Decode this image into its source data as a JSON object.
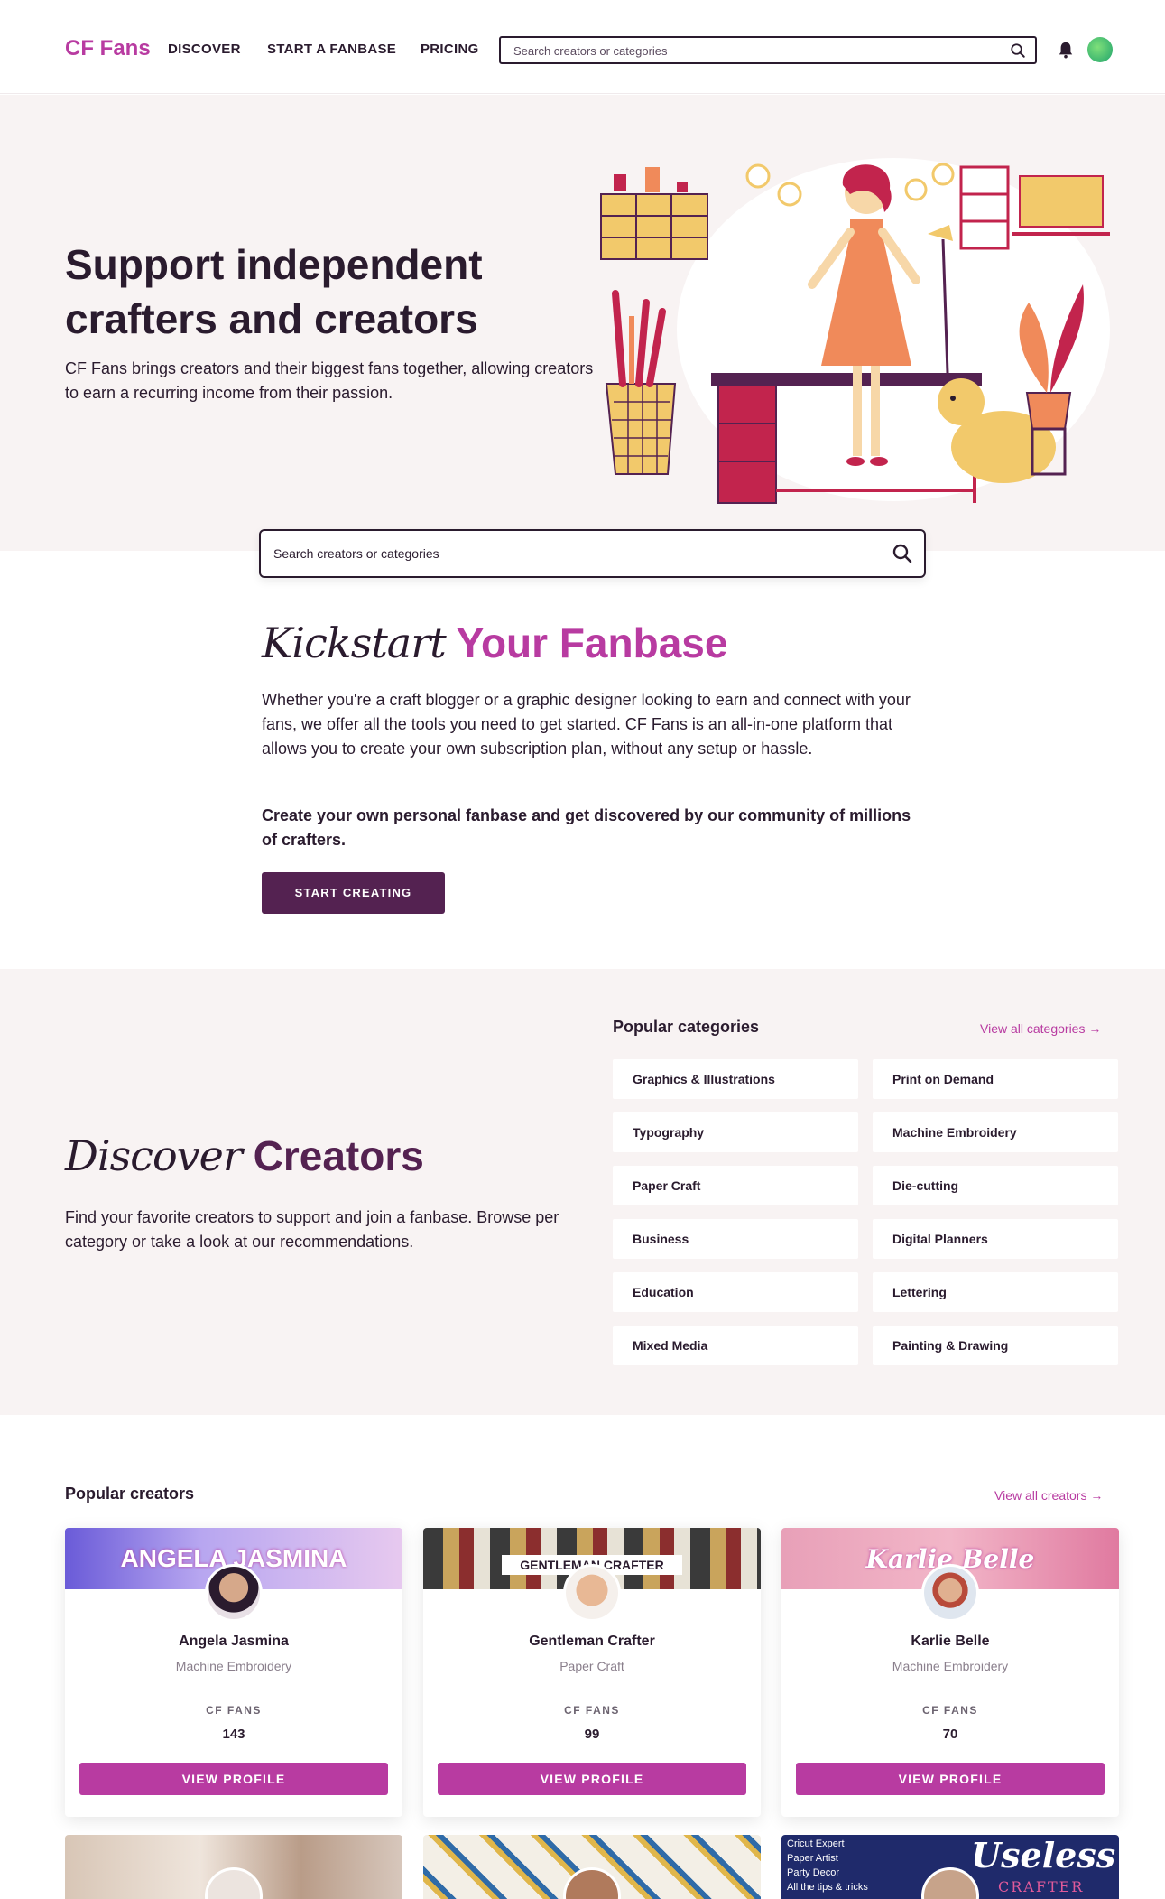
{
  "header": {
    "logo": "CF Fans",
    "nav": [
      "DISCOVER",
      "START A FANBASE",
      "PRICING"
    ],
    "search_placeholder": "Search creators or categories"
  },
  "hero": {
    "title": "Support independent crafters and creators",
    "subtitle": "CF Fans brings creators and their biggest fans together, allowing creators to earn a recurring income from their passion."
  },
  "big_search": {
    "placeholder": "Search creators or categories"
  },
  "kickstart": {
    "title_script": "Kickstart",
    "title_accent": "Your Fanbase",
    "paragraph": "Whether you're a craft blogger or a graphic designer looking to earn and connect with your fans, we offer all the tools you need to get started. CF Fans is an all-in-one platform that allows you to create your own subscription plan, without any setup or hassle.",
    "bold_paragraph": "Create your own personal fanbase and get discovered by our community of millions of crafters.",
    "button": "START CREATING"
  },
  "discover": {
    "title_script": "Discover",
    "title_accent": "Creators",
    "paragraph": "Find your favorite creators to support and join a fanbase. Browse per category or take a look at our recommendations.",
    "categories_heading": "Popular categories",
    "view_all": "View all categories →",
    "categories": [
      "Graphics & Illustrations",
      "Print on Demand",
      "Typography",
      "Machine Embroidery",
      "Paper Craft",
      "Die-cutting",
      "Business",
      "Digital Planners",
      "Education",
      "Lettering",
      "Mixed Media",
      "Painting & Drawing"
    ]
  },
  "popular": {
    "heading": "Popular creators",
    "view_all": "View all creators →",
    "fans_label": "CF FANS",
    "button": "VIEW PROFILE",
    "creators": [
      {
        "name": "Angela Jasmina",
        "category": "Machine Embroidery",
        "fans": "143",
        "banner": "ANGELA JASMINA"
      },
      {
        "name": "Gentleman Crafter",
        "category": "Paper Craft",
        "fans": "99",
        "banner": "GENTLEMAN CRAFTER"
      },
      {
        "name": "Karlie Belle",
        "category": "Machine Embroidery",
        "fans": "70",
        "banner": "Karlie Belle"
      }
    ],
    "next_row": [
      {
        "banner_lines": []
      },
      {
        "banner_lines": []
      },
      {
        "banner_lines": [
          "Cricut Expert",
          "Paper Artist",
          "Party Decor",
          "All the tips & tricks"
        ],
        "banner_title": "Useless",
        "banner_sub": "CRAFTER"
      }
    ]
  },
  "colors": {
    "brand": "#b83ba1",
    "dark_purple": "#542251",
    "ink": "#2a1b2e",
    "bg_soft": "#f8f3f3"
  }
}
